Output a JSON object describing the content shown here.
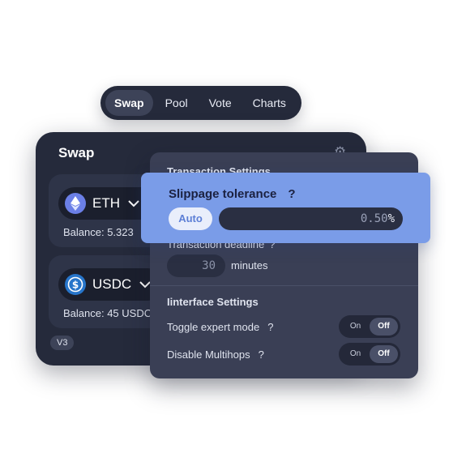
{
  "nav": {
    "items": [
      {
        "label": "Swap",
        "active": true
      },
      {
        "label": "Pool",
        "active": false
      },
      {
        "label": "Vote",
        "active": false
      },
      {
        "label": "Charts",
        "active": false
      }
    ]
  },
  "swap": {
    "title": "Swap",
    "settings_icon": "gear-icon",
    "tokens": [
      {
        "symbol": "ETH",
        "icon": "ethereum-icon",
        "balance": "Balance: 5.323"
      },
      {
        "symbol": "USDC",
        "icon": "usdc-icon",
        "balance": "Balance: 45 USDC"
      }
    ],
    "version": "V3"
  },
  "settings": {
    "transaction_title": "Transaction Settings",
    "slippage": {
      "label": "Slippage tolerance",
      "help": "?",
      "auto_label": "Auto",
      "value": "0.50",
      "unit": "%"
    },
    "deadline": {
      "label": "Transaction deadline",
      "help": "?",
      "value": "30",
      "unit": "minutes"
    },
    "interface_title": "Iinterface Settings",
    "toggles": [
      {
        "label": "Toggle expert mode",
        "help": "?",
        "on": "On",
        "off": "Off",
        "selected": "Off"
      },
      {
        "label": "Disable Multihops",
        "help": "?",
        "on": "On",
        "off": "Off",
        "selected": "Off"
      }
    ]
  },
  "colors": {
    "panel_dark": "#252a3b",
    "settings_panel": "#3a3f55",
    "slippage_highlight": "#7a9ce8",
    "auto_text": "#5d7fd6"
  }
}
